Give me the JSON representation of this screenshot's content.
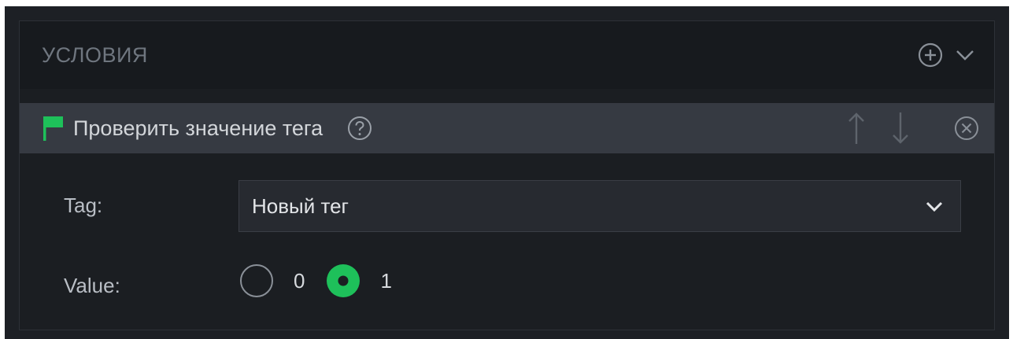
{
  "section": {
    "title": "УСЛОВИЯ",
    "add_icon": "plus-circle-icon",
    "collapse_icon": "chevron-down-icon"
  },
  "condition": {
    "icon": "flag-icon",
    "title": "Проверить значение тега",
    "help_icon": "question-circle-icon",
    "move_up_icon": "arrow-up-icon",
    "move_down_icon": "arrow-down-icon",
    "remove_icon": "close-circle-icon"
  },
  "form": {
    "tag": {
      "label": "Tag:",
      "value": "Новый тег",
      "dropdown_icon": "chevron-down-icon"
    },
    "value": {
      "label": "Value:",
      "options": [
        "0",
        "1"
      ],
      "selected": "1"
    }
  },
  "colors": {
    "accent": "#1ec05a",
    "panel_bg": "#1b1e22",
    "header_bg": "#171a1e",
    "condition_bar_bg": "#363a42"
  }
}
